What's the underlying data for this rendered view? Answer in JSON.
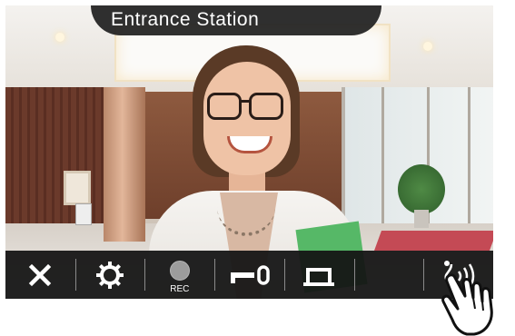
{
  "station": {
    "title": "Entrance Station"
  },
  "controls": {
    "rec_label": "REC",
    "rec_dot_color": "#9c9c9c",
    "buttons": [
      {
        "id": "close",
        "icon": "close-icon"
      },
      {
        "id": "settings",
        "icon": "gear-icon"
      },
      {
        "id": "record",
        "icon": "record-icon"
      },
      {
        "id": "unlock",
        "icon": "key-icon"
      },
      {
        "id": "door",
        "icon": "door-release-icon"
      },
      {
        "id": "blank",
        "icon": ""
      },
      {
        "id": "talk",
        "icon": "talk-icon"
      }
    ]
  },
  "colors": {
    "bar": "#141414",
    "icon": "#ffffff",
    "title_text": "#ffffff"
  }
}
